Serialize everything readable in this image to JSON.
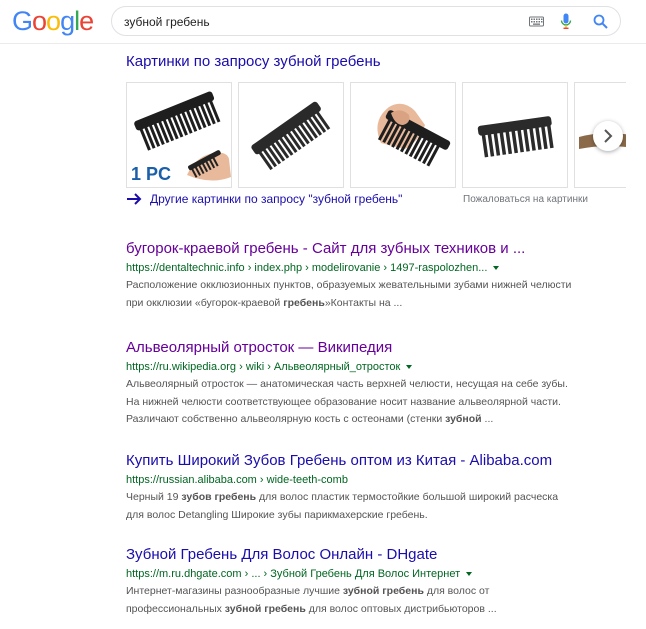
{
  "logo": {
    "letters": [
      "G",
      "o",
      "o",
      "g",
      "l",
      "e"
    ],
    "colors": [
      "#4285f4",
      "#ea4335",
      "#fbbc05",
      "#4285f4",
      "#34a853",
      "#ea4335"
    ]
  },
  "search": {
    "query": "зубной гребень"
  },
  "icons": {
    "keyboard": "keyboard-icon",
    "mic": "microphone-icon",
    "search": "search-icon",
    "next": "chevron-right-icon",
    "arrow": "arrow-right-icon"
  },
  "images": {
    "title": "Картинки по запросу зубной гребень",
    "more_label": "Другие картинки по запросу \"зубной гребень\"",
    "complain_label": "Пожаловаться на картинки",
    "thumb_badge": "1 PC"
  },
  "results": [
    {
      "title": "бугорок-краевой гребень - Сайт для зубных техников и ...",
      "url": "https://dentaltechnic.info › index.php › modelirovanie › 1497-raspolozhen...",
      "snippet": [
        [
          "Расположение окклюзионных пунктов, образуемых жевательными зубами нижней челюсти",
          ""
        ],
        [
          "при окклюзии «бугорок-краевой ",
          "гребень",
          "»Контакты на ..."
        ]
      ]
    },
    {
      "title": "Альвеолярный отросток — Википедия",
      "url": "https://ru.wikipedia.org › wiki › Альвеолярный_отросток",
      "snippet": [
        [
          "Альвеолярный отросток — анатомическая часть верхней челюсти, несущая на себе зубы.",
          ""
        ],
        [
          "На нижней челюсти соответствующее образование носит название альвеолярной части.",
          ""
        ],
        [
          "Различают собственно альвеолярную кость с остеонами (стенки ",
          "зубной",
          " ..."
        ]
      ]
    },
    {
      "title": "Купить Широкий Зубов Гребень оптом из Китая - Alibaba.com",
      "url": "https://russian.alibaba.com › wide-teeth-comb",
      "snippet": [
        [
          "Черный 19 ",
          "зубов гребень",
          " для волос пластик термостойкие большой широкий расческа"
        ],
        [
          "для волос Detangling Широкие зубы парикмахерские гребень.",
          ""
        ]
      ]
    },
    {
      "title": "Зубной Гребень Для Волос Онлайн - DHgate",
      "url": "https://m.ru.dhgate.com › ... › Зубной Гребень Для Волос Интернет",
      "snippet": [
        [
          "Интернет-магазины разнообразные лучшие ",
          "зубной гребень",
          " для волос от"
        ],
        [
          "профессиональных ",
          "зубной гребень",
          " для волос оптовых дистрибьюторов ..."
        ]
      ]
    }
  ]
}
